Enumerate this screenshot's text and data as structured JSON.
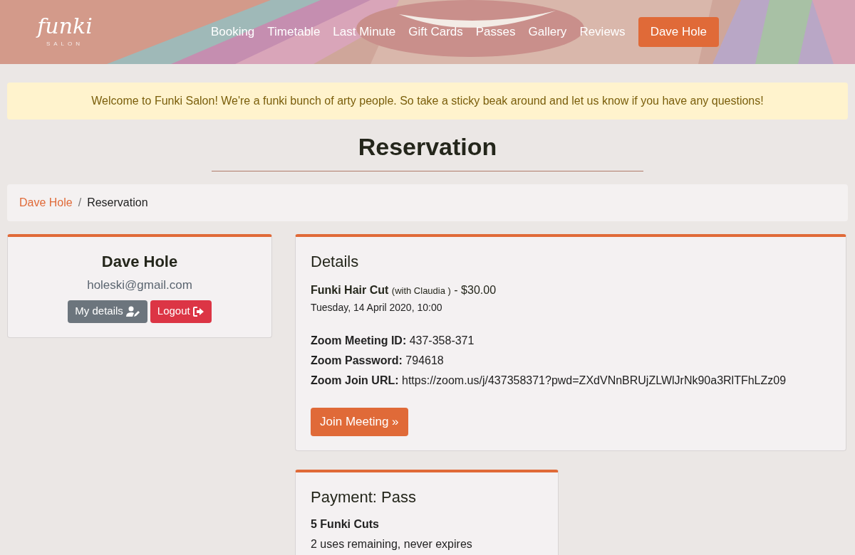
{
  "header": {
    "logo": {
      "name": "funki",
      "tagline": "SALON"
    },
    "nav": [
      {
        "label": "Booking",
        "kind": "link"
      },
      {
        "label": "Timetable",
        "kind": "link"
      },
      {
        "label": "Last Minute",
        "kind": "link"
      },
      {
        "label": "Gift Cards",
        "kind": "link"
      },
      {
        "label": "Passes",
        "kind": "link"
      },
      {
        "label": "Gallery",
        "kind": "link"
      },
      {
        "label": "Reviews",
        "kind": "link"
      },
      {
        "label": "Dave Hole",
        "kind": "button"
      }
    ]
  },
  "welcome": "Welcome to Funki Salon! We're a funki bunch of arty people. So take a sticky beak around and let us know if you have any questions!",
  "page_title": "Reservation",
  "breadcrumb_separator": "/",
  "breadcrumb": [
    {
      "label": "Dave Hole",
      "kind": "link"
    },
    {
      "label": "Reservation",
      "kind": "current"
    }
  ],
  "profile": {
    "name": "Dave Hole",
    "email": "holeski@gmail.com",
    "buttons": [
      {
        "label": "My details",
        "kind": "details"
      },
      {
        "label": "Logout",
        "kind": "logout"
      }
    ]
  },
  "details": {
    "title": "Details",
    "service": "**Funki Hair Cut** (with Claudia ) - $30.00",
    "datetime": "Tuesday, 14 April 2020, 10:00",
    "zoom": [
      {
        "label": "Zoom Meeting ID:",
        "value": "437-358-371"
      },
      {
        "label": "Zoom Password:",
        "value": "794618"
      },
      {
        "label": "Zoom Join URL:",
        "value": "https://zoom.us/j/437358371?pwd=ZXdVNnBRUjZLWlJrNk90a3RlTFhLZz09"
      }
    ],
    "button": "Join Meeting »"
  },
  "payment": {
    "title": "Payment: Pass",
    "pass_name": "5 Funki Cuts",
    "note": "2 uses remaining, never expires"
  }
}
